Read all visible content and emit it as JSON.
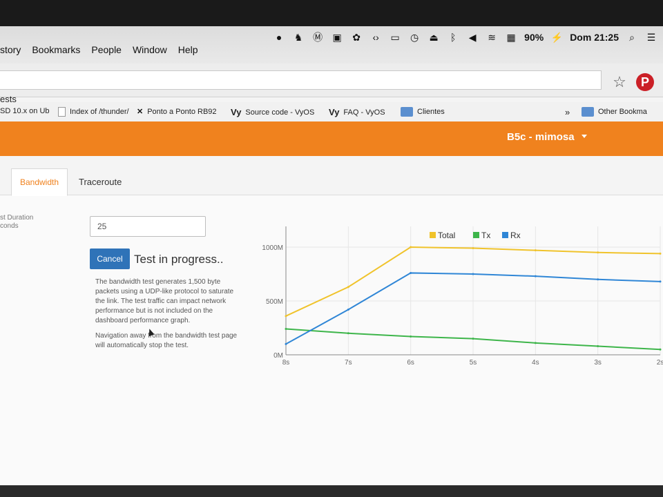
{
  "menubar": {
    "menus": [
      "story",
      "Bookmarks",
      "People",
      "Window",
      "Help"
    ],
    "battery": "90%",
    "clock": "Dom 21:25"
  },
  "browser": {
    "tab_title": "ests",
    "bookmarks": [
      {
        "label": "SD 10.x on Ub"
      },
      {
        "label": "Index of /thunder/"
      },
      {
        "label": "Ponto a Ponto RB92"
      },
      {
        "label": "Source code - VyOS"
      },
      {
        "label": "FAQ - VyOS"
      },
      {
        "label": "Clientes"
      }
    ],
    "overflow_label": "»",
    "other_bookmarks": "Other Bookma",
    "vyos_prefix": "Vy"
  },
  "app": {
    "device_name": "B5c - mimosa",
    "tabs": [
      {
        "label": "Bandwidth"
      },
      {
        "label": "Traceroute"
      }
    ],
    "duration_label_1": "st Duration",
    "duration_label_2": "conds",
    "duration_value": "25",
    "cancel_label": "Cancel",
    "progress_text": "Test in progress..",
    "description": "The bandwidth test generates 1,500 byte packets using a UDP-like protocol to saturate the link. The test traffic can impact network performance but is not included on the dashboard performance graph.",
    "navigation_note": "Navigation away from the bandwidth test page will automatically stop the test."
  },
  "icons": {
    "star": "☆",
    "pinterest": "P"
  },
  "colors": {
    "total": "#f0c32b",
    "tx": "#3db54a",
    "rx": "#2f86d6",
    "header": "#f0821e"
  },
  "chart_data": {
    "type": "line",
    "x": [
      "8s",
      "7s",
      "6s",
      "5s",
      "4s",
      "3s",
      "2s"
    ],
    "ylim": [
      0,
      1000
    ],
    "yticks": [
      "0M",
      "500M",
      "1000M"
    ],
    "legend": "top-center",
    "series": [
      {
        "name": "Total",
        "values": [
          360,
          630,
          1000,
          990,
          970,
          950,
          940
        ]
      },
      {
        "name": "Tx",
        "values": [
          240,
          200,
          170,
          150,
          110,
          80,
          50
        ]
      },
      {
        "name": "Rx",
        "values": [
          100,
          420,
          760,
          750,
          730,
          700,
          680
        ]
      }
    ]
  }
}
